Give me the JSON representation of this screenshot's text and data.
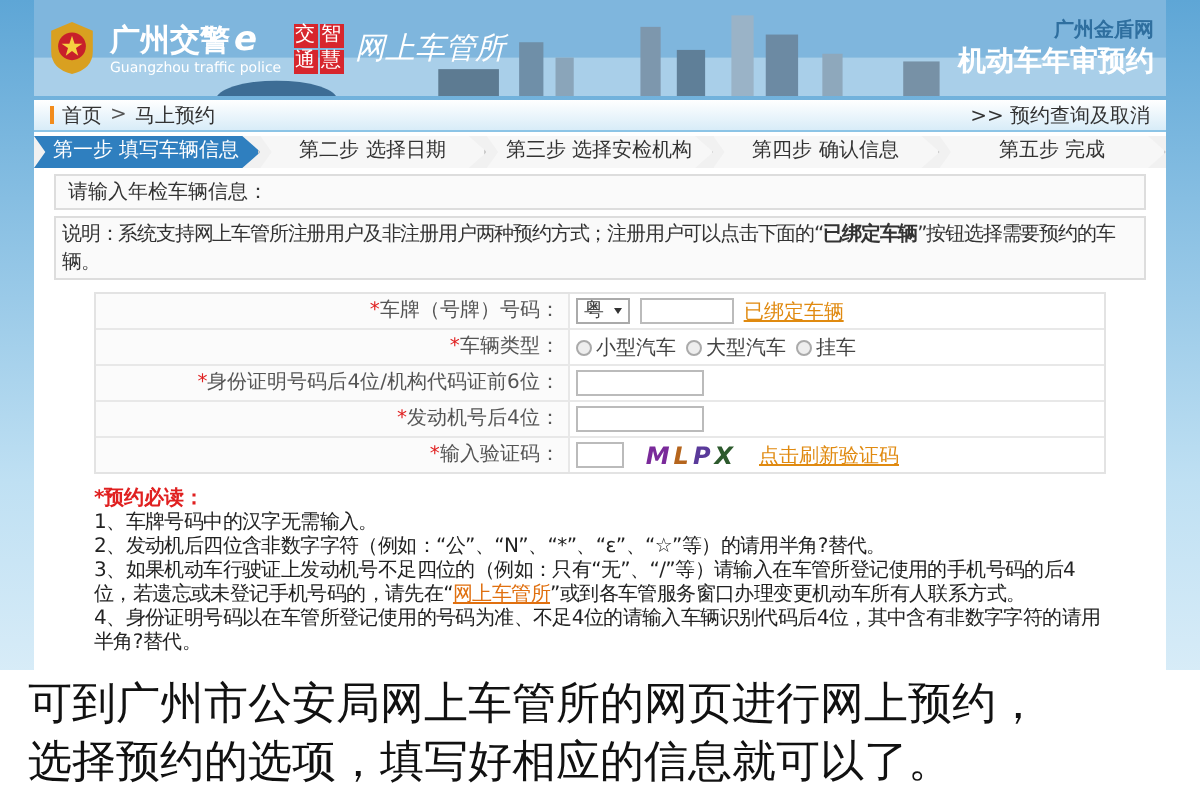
{
  "header": {
    "title": "广州交警",
    "title_mark": "e",
    "subtitle": "Guangzhou traffic police",
    "badge": [
      "交",
      "智",
      "通",
      "慧"
    ],
    "portal": "网上车管所",
    "site": "广州金盾网",
    "page_title": "机动车年审预约"
  },
  "breadcrumb": {
    "home": "首页",
    "separator": ">",
    "current": "马上预约",
    "link": ">> 预约查询及取消"
  },
  "steps": [
    {
      "label": "第一步 填写车辆信息",
      "selected": true
    },
    {
      "label": "第二步 选择日期",
      "selected": false
    },
    {
      "label": "第三步 选择安检机构",
      "selected": false
    },
    {
      "label": "第四步 确认信息",
      "selected": false
    },
    {
      "label": "第五步 完成",
      "selected": false
    }
  ],
  "section_title": "请输入年检车辆信息：",
  "notice": "说明：系统支持网上车管所注册用户及非注册用户两种预约方式；注册用户可以点击下面的“**已绑定车辆**”按钮选择需要预约的车辆。",
  "form": [
    {
      "kind": "plate",
      "mark": "*",
      "label": "车牌（号牌）号码：",
      "select": "粤",
      "link": "已绑定车辆"
    },
    {
      "kind": "radio",
      "mark": "*",
      "label": "车辆类型：",
      "options": [
        {
          "label": "小型汽车",
          "selected": false
        },
        {
          "label": "大型汽车",
          "selected": false
        },
        {
          "label": "挂车",
          "selected": false
        }
      ]
    },
    {
      "kind": "text",
      "mark": "*",
      "label": "身份证明号码后4位/机构代码证前6位："
    },
    {
      "kind": "text",
      "mark": "*",
      "label": "发动机号后4位："
    },
    {
      "kind": "captcha",
      "mark": "*",
      "label": "输入验证码：",
      "captcha": "MLPX",
      "link": "点击刷新验证码"
    }
  ],
  "notes": {
    "title": "*预约必读：",
    "items": [
      {
        "text": "1、车牌号码中的汉字无需输入。"
      },
      {
        "text": "2、发动机后四位含非数字字符（例如：“公”、“N”、“*”、“ε”、“☆”等）的请用半角?替代。"
      },
      {
        "text": "3、如果机动车行驶证上发动机号不足四位的（例如：只有“无”、“/”等）请输入在车管所登记使用的手机号码的后4位，若遗忘或未登记手机号码的，请先在“",
        "link": "网上车管所",
        "after": "”或到各车管服务窗口办理变更机动车所有人联系方式。"
      },
      {
        "text": "4、身份证明号码以在车管所登记使用的号码为准、不足4位的请输入车辆识别代码后4位，其中含有非数字字符的请用半角?替代。"
      }
    ]
  },
  "caption": [
    "可到广州市公安局网上车管所的网页进行网上预约，",
    "选择预约的选项，填写好相应的信息就可以了。"
  ]
}
